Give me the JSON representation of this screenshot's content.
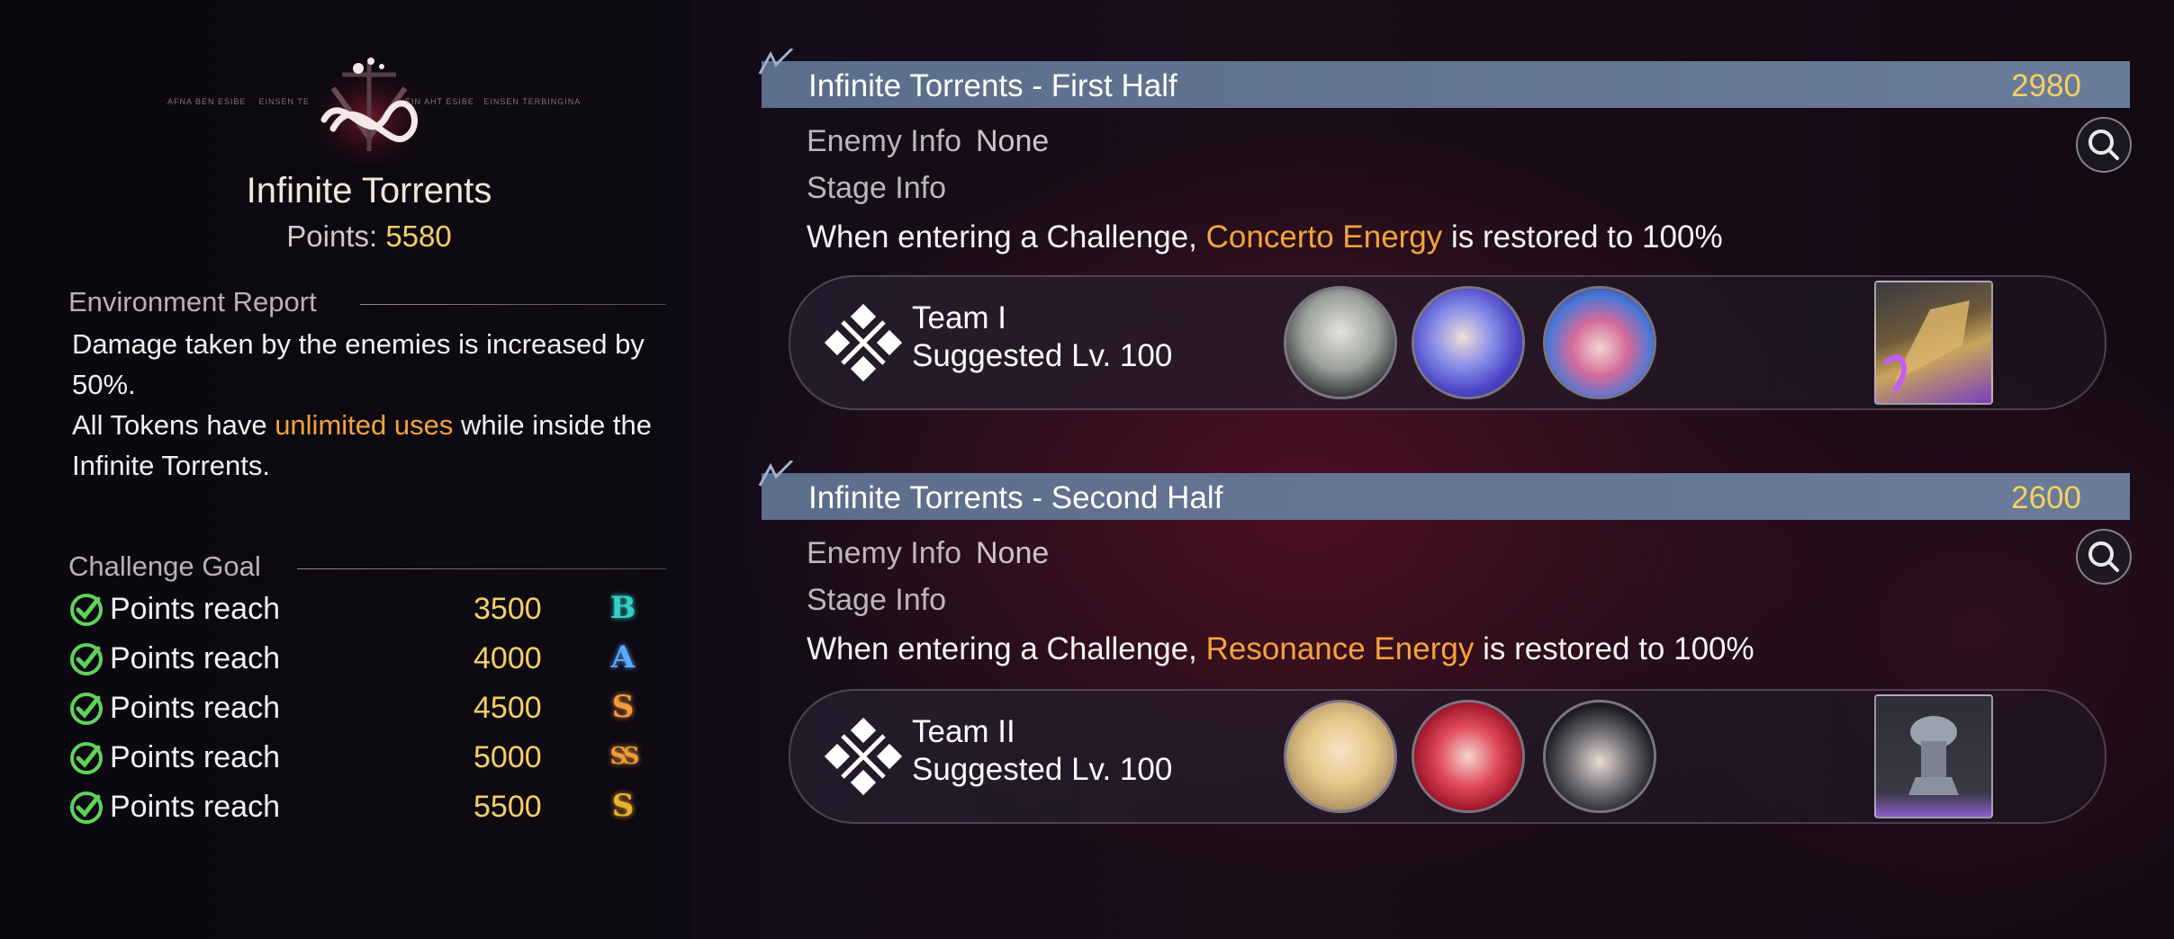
{
  "left": {
    "title": "Infinite Torrents",
    "points_label": "Points:",
    "points_value": "5580",
    "environment_report_heading": "Environment Report",
    "environment_line1": "Damage taken by the enemies is increased by 50%.",
    "environment_line2_prefix": "All Tokens have",
    "environment_line2_highlight": "unlimited uses",
    "environment_line2_suffix": "while inside the Infinite Torrents.",
    "challenge_goal_heading": "Challenge Goal",
    "goals": [
      {
        "label": "Points reach",
        "value": "3500",
        "grade": "B",
        "grade_color": "#31d1c6",
        "achieved": true
      },
      {
        "label": "Points reach",
        "value": "4000",
        "grade": "A",
        "grade_color": "#5aa8ff",
        "achieved": true
      },
      {
        "label": "Points reach",
        "value": "4500",
        "grade": "S",
        "grade_color": "#f09a3a",
        "achieved": true
      },
      {
        "label": "Points reach",
        "value": "5000",
        "grade": "SS",
        "grade_color": "#f09a3a",
        "achieved": true
      },
      {
        "label": "Points reach",
        "value": "5500",
        "grade": "S",
        "grade_color": "#f0b030",
        "achieved": true
      }
    ]
  },
  "stages": [
    {
      "title": "Infinite Torrents - First Half",
      "points": "2980",
      "enemy_info_label": "Enemy Info",
      "enemy_info_value": "None",
      "stage_info_label": "Stage Info",
      "desc_prefix": "When entering a Challenge,",
      "desc_highlight": "Concerto Energy",
      "desc_suffix": "is restored to 100%",
      "team_name": "Team I",
      "team_level": "Suggested Lv. 100"
    },
    {
      "title": "Infinite Torrents - Second Half",
      "points": "2600",
      "enemy_info_label": "Enemy Info",
      "enemy_info_value": "None",
      "stage_info_label": "Stage Info",
      "desc_prefix": "When entering a Challenge,",
      "desc_highlight": "Resonance Energy",
      "desc_suffix": "is restored to 100%",
      "team_name": "Team II",
      "team_level": "Suggested Lv. 100"
    }
  ],
  "colors": {
    "gold": "#f5d063",
    "orange_highlight": "#f5a33b",
    "header_bar": "#6a7f9e",
    "check_green": "#5fd25a"
  },
  "icons": {
    "goal_check": "check-circle-icon",
    "search": "magnifier-icon",
    "team": "crossed-swords-diamond-icon"
  }
}
